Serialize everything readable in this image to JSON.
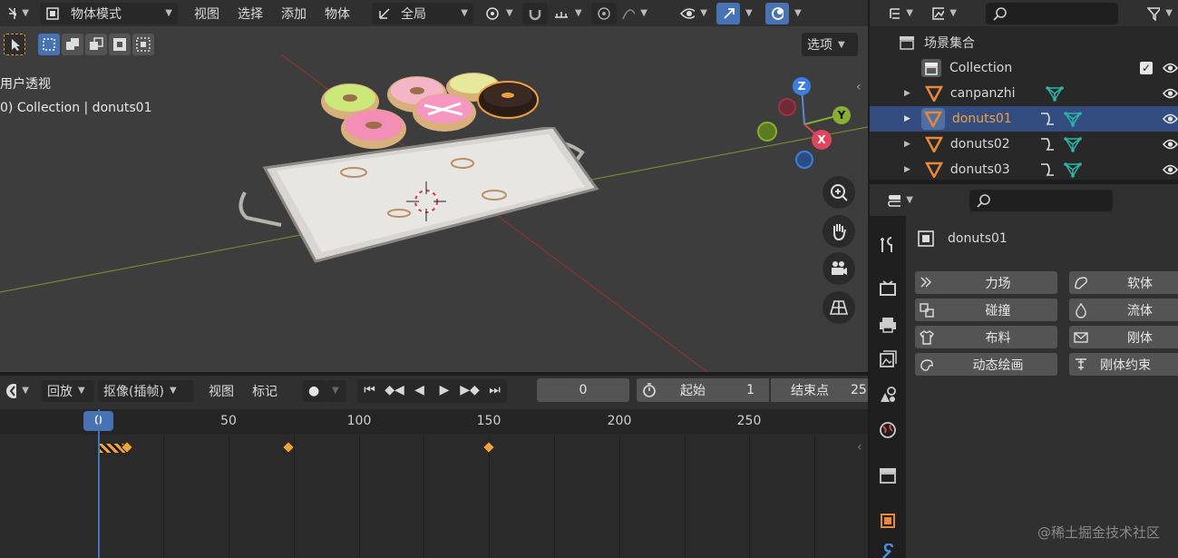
{
  "viewport": {
    "mode_label": "物体模式",
    "menus": [
      "视图",
      "选择",
      "添加",
      "物体"
    ],
    "transform_orientation": "全局",
    "options_label": "选项",
    "view_name": "用户透视",
    "collection_info": "0) Collection | donuts01",
    "gizmo": {
      "z": "Z",
      "y": "Y",
      "x": "X"
    }
  },
  "outliner": {
    "scene_collection": "场景集合",
    "items": [
      {
        "name": "Collection"
      },
      {
        "name": "canpanzhi"
      },
      {
        "name": "donuts01"
      },
      {
        "name": "donuts02"
      },
      {
        "name": "donuts03"
      }
    ]
  },
  "properties": {
    "object_name": "donuts01",
    "physics_left": [
      "力场",
      "碰撞",
      "布料",
      "动态绘画"
    ],
    "physics_right": [
      "软体",
      "流体",
      "刚体",
      "刚体约束"
    ]
  },
  "timeline": {
    "playback_label": "回放",
    "keying_label": "抠像(插帧)",
    "view_label": "视图",
    "marker_label": "标记",
    "current_frame": "0",
    "start_label": "起始",
    "start_value": "1",
    "end_label": "结束点",
    "end_value": "25",
    "ruler": [
      "0",
      "50",
      "100",
      "150",
      "200",
      "250"
    ]
  },
  "watermark": "@稀土掘金技术社区",
  "colors": {
    "accent_blue": "#4772b3",
    "selected_row": "#334d80",
    "keyframe": "#f2a43a",
    "object_orange": "#e8883a",
    "mesh_teal": "#2bb5a8"
  }
}
